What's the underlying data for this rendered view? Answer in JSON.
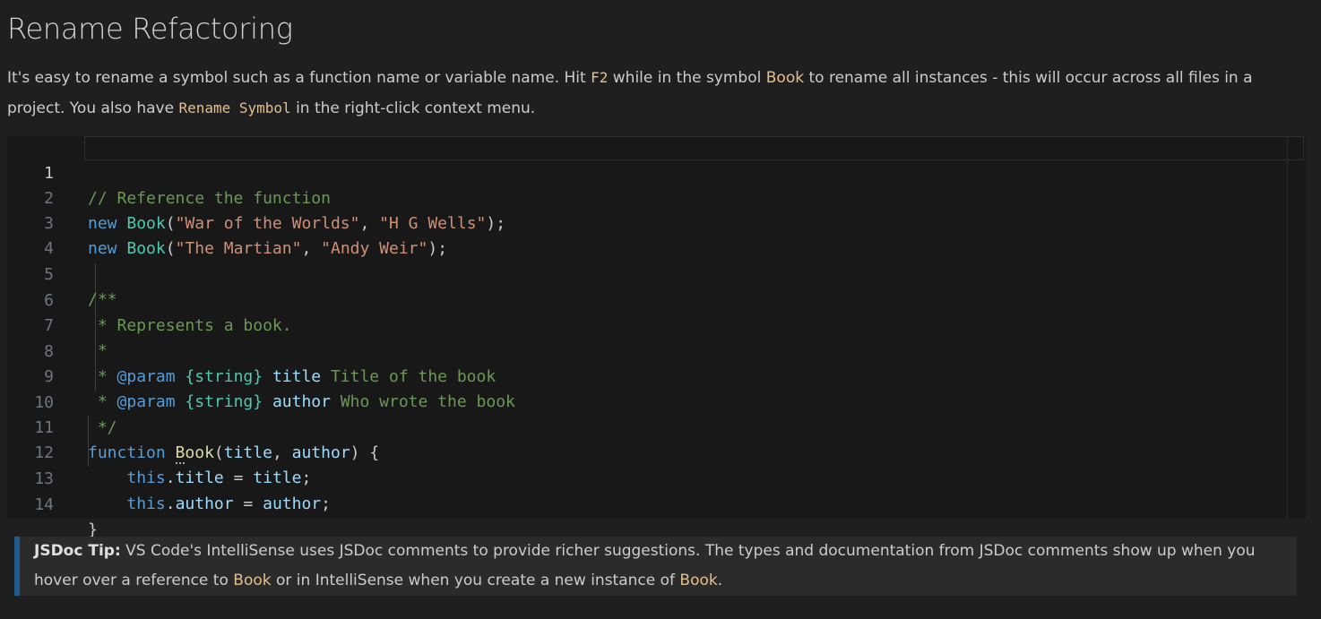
{
  "page": {
    "title": "Rename Refactoring",
    "description": {
      "part1": "It's easy to rename a symbol such as a function name or variable name. Hit ",
      "key": "F2",
      "part2": " while in the symbol ",
      "symbol": "Book",
      "part3": " to rename all instances - this will occur across all files in a project. You also have ",
      "command": "Rename Symbol",
      "part4": " in the right-click context menu."
    }
  },
  "editor": {
    "line_numbers": [
      "1",
      "2",
      "3",
      "4",
      "5",
      "6",
      "7",
      "8",
      "9",
      "10",
      "11",
      "12",
      "13",
      "14"
    ],
    "lines": {
      "l1": {
        "comment": "// Reference the function"
      },
      "l2": {
        "kw": "new",
        "cls": "Book",
        "p1": "(",
        "s1": "\"War of the Worlds\"",
        "p2": ", ",
        "s2": "\"H G Wells\"",
        "p3": ");"
      },
      "l3": {
        "kw": "new",
        "cls": "Book",
        "p1": "(",
        "s1": "\"The Martian\"",
        "p2": ", ",
        "s2": "\"Andy Weir\"",
        "p3": ");"
      },
      "l5": {
        "comment": "/**"
      },
      "l6": {
        "comment": " * Represents a book."
      },
      "l7": {
        "comment": " *"
      },
      "l8": {
        "star": " * ",
        "tag": "@param",
        "sp": " ",
        "type": "{string}",
        "sp2": " ",
        "name": "title",
        "desc": " Title of the book"
      },
      "l9": {
        "star": " * ",
        "tag": "@param",
        "sp": " ",
        "type": "{string}",
        "sp2": " ",
        "name": "author",
        "desc": " Who wrote the book"
      },
      "l10": {
        "comment": " */"
      },
      "l11": {
        "kw": "function",
        "sp": " ",
        "fn_first": "B",
        "fn_rest": "ook",
        "p1": "(",
        "a1": "title",
        "p2": ", ",
        "a2": "author",
        "p3": ") {"
      },
      "l12": {
        "indent": "    ",
        "kw": "this",
        "dot": ".",
        "prop": "title",
        "op": " = ",
        "val": "title",
        "end": ";"
      },
      "l13": {
        "indent": "    ",
        "kw": "this",
        "dot": ".",
        "prop": "author",
        "op": " = ",
        "val": "author",
        "end": ";"
      },
      "l14": {
        "brace": "}"
      }
    }
  },
  "tip": {
    "label": "JSDoc Tip:",
    "part1": " VS Code's IntelliSense uses JSDoc comments to provide richer suggestions. The types and documentation from JSDoc comments show up when you hover over a reference to ",
    "symbol1": "Book",
    "part2": " or in IntelliSense when you create a new instance of ",
    "symbol2": "Book",
    "part3": "."
  },
  "colors": {
    "background": "#1f1f1f",
    "editor_background": "#181818",
    "comment": "#6a9955",
    "keyword": "#569cd6",
    "class": "#4ec9b0",
    "string": "#ce9178",
    "function": "#dcdcaa",
    "variable": "#9cdcfe",
    "highlight": "#e2c08d",
    "tip_border": "#1e5c8f"
  }
}
